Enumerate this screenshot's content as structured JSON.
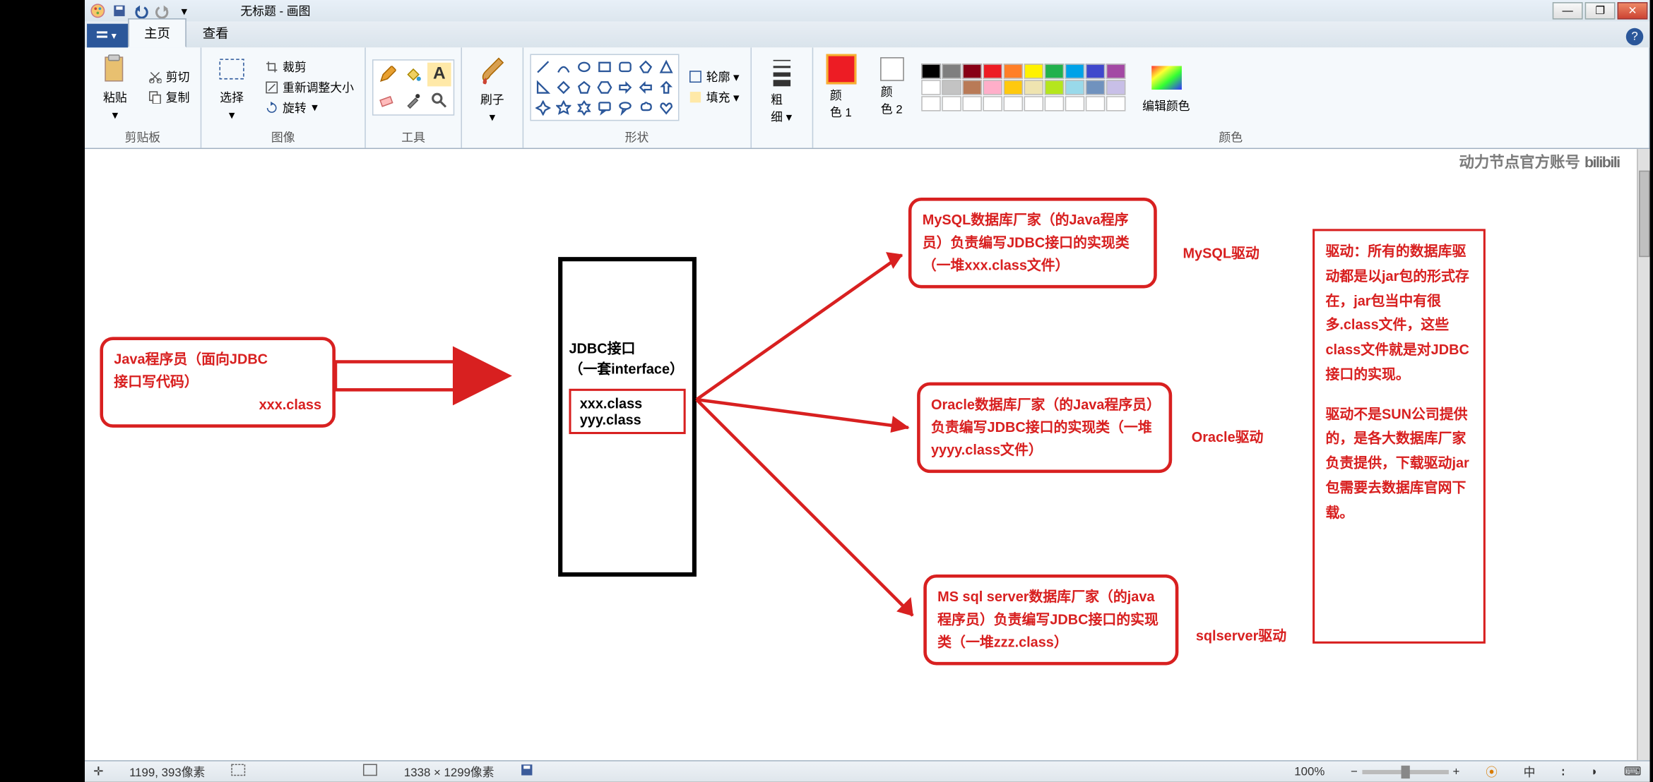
{
  "window": {
    "title": "无标题 - 画图"
  },
  "tabs": {
    "home": "主页",
    "view": "查看"
  },
  "groups": {
    "clipboard": {
      "paste": "粘贴",
      "cut": "剪切",
      "copy": "复制",
      "label": "剪贴板"
    },
    "image": {
      "select": "选择",
      "crop": "裁剪",
      "resize": "重新调整大小",
      "rotate": "旋转",
      "label": "图像"
    },
    "tools": {
      "label": "工具"
    },
    "brush": {
      "label": "刷子"
    },
    "shapes": {
      "outline": "轮廓",
      "fill": "填充",
      "label": "形状"
    },
    "thickness": {
      "label1": "粗",
      "label2": "细"
    },
    "colors": {
      "color1": "颜\n色 1",
      "color2": "颜\n色 2",
      "edit": "编辑颜色",
      "label": "颜色"
    }
  },
  "palette_row1": [
    "#000000",
    "#7f7f7f",
    "#880015",
    "#ed1c24",
    "#ff7f27",
    "#fff200",
    "#22b14c",
    "#00a2e8",
    "#3f48cc",
    "#a349a4"
  ],
  "palette_row2": [
    "#ffffff",
    "#c3c3c3",
    "#b97a57",
    "#ffaec9",
    "#ffc90e",
    "#efe4b0",
    "#b5e61d",
    "#99d9ea",
    "#7092be",
    "#c8bfe7"
  ],
  "palette_row3": [
    "#ffffff",
    "#ffffff",
    "#ffffff",
    "#ffffff",
    "#ffffff",
    "#ffffff",
    "#ffffff",
    "#ffffff",
    "#ffffff",
    "#ffffff"
  ],
  "watermark": {
    "text": "动力节点官方账号",
    "logo": "bilibili"
  },
  "diagram": {
    "left_box_l1": "Java程序员（面向JDBC",
    "left_box_l2": "接口写代码）",
    "left_box_l3": "xxx.class",
    "center_title": "JDBC接口",
    "center_sub": "（一套interface）",
    "center_inner1": "xxx.class",
    "center_inner2": "yyy.class",
    "mysql_box": "MySQL数据库厂家（的Java程序员）负责编写JDBC接口的实现类 （一堆xxx.class文件）",
    "mysql_label": "MySQL驱动",
    "oracle_box": "Oracle数据库厂家（的Java程序员）负责编写JDBC接口的实现类（一堆yyyy.class文件）",
    "oracle_label": "Oracle驱动",
    "mssql_box": "MS sql server数据库厂家（的java程序员）负责编写JDBC接口的实现类（一堆zzz.class）",
    "mssql_label": "sqlserver驱动",
    "note_p1": "驱动：所有的数据库驱动都是以jar包的形式存在，jar包当中有很多.class文件，这些class文件就是对JDBC接口的实现。",
    "note_p2": "驱动不是SUN公司提供的，是各大数据库厂家负责提供，下载驱动jar包需要去数据库官网下载。"
  },
  "status": {
    "cursor_pos": "1199, 393像素",
    "canvas_size": "1338 × 1299像素",
    "zoom": "100%"
  },
  "ime_indicators": [
    "中",
    "ᴶ",
    "ᴶ"
  ]
}
